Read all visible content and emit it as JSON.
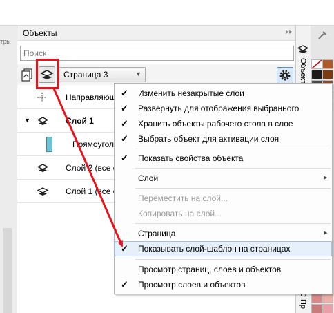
{
  "left_strip": {
    "label": "тры"
  },
  "panel": {
    "title": "Объекты",
    "pin_icon": "double-arrow-icon",
    "close_icon": "close-icon",
    "search_placeholder": "Поиск",
    "page_select": {
      "value": "Страница 3"
    },
    "tree": [
      {
        "label": "Направляющ...",
        "kind": "guides"
      },
      {
        "label": "Слой 1",
        "kind": "layer",
        "expanded": true
      },
      {
        "label": "Прямоугол...",
        "kind": "object"
      },
      {
        "label": "Слой 2 (все с...",
        "kind": "layer"
      },
      {
        "label": "Слой 1 (все с...",
        "kind": "layer"
      }
    ]
  },
  "right_docker": {
    "tab_label": "Объекты",
    "tab_label_bottom": "С Пр"
  },
  "context_menu": {
    "items": [
      {
        "label": "Изменить незакрытые слои",
        "checked": true
      },
      {
        "label": "Развернуть для отображения выбранного",
        "checked": true
      },
      {
        "label": "Хранить объекты рабочего стола в слое",
        "checked": true
      },
      {
        "label": "Выбрать объект для активации слоя",
        "checked": true
      },
      {
        "label": "Показать свойства объекта",
        "checked": true
      },
      {
        "label": "Слой",
        "submenu": true
      },
      {
        "label": "Переместить на слой...",
        "disabled": true
      },
      {
        "label": "Копировать на слой...",
        "disabled": true
      },
      {
        "label": "Страница",
        "submenu": true
      },
      {
        "label": "Показывать слой-шаблон на страницах",
        "checked": true,
        "highlighted": true
      },
      {
        "label": "Просмотр страниц, слоев и объектов"
      },
      {
        "label": "Просмотр слоев и объектов",
        "checked": true
      }
    ]
  },
  "colors": {
    "annotation_red": "#e8121b",
    "highlight_bg": "#e5f0fb",
    "selected_icon_bg": "#dbe8f8"
  }
}
